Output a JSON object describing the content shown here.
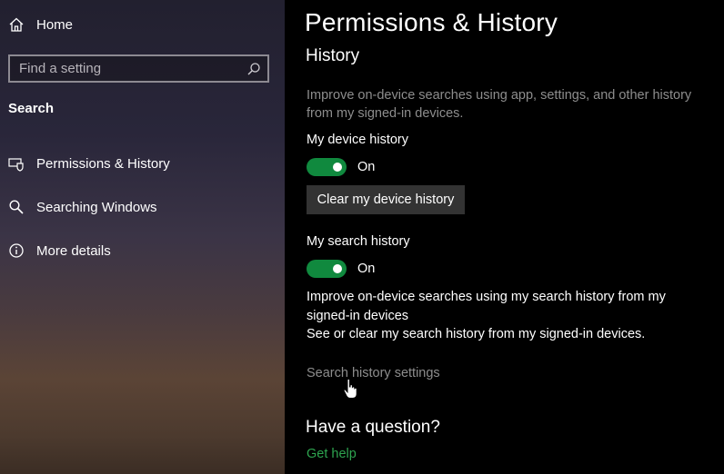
{
  "sidebar": {
    "home_label": "Home",
    "search_placeholder": "Find a setting",
    "section_title": "Search",
    "items": [
      {
        "label": "Permissions & History",
        "icon": "permissions-icon"
      },
      {
        "label": "Searching Windows",
        "icon": "search-icon"
      },
      {
        "label": "More details",
        "icon": "info-icon"
      }
    ]
  },
  "main": {
    "page_title": "Permissions & History",
    "history_heading": "History",
    "intro": "Improve on-device searches using app, settings, and other history from my signed-in devices.",
    "device_history": {
      "label": "My device history",
      "toggle_state": "On",
      "clear_button": "Clear my device history"
    },
    "search_history": {
      "label": "My search history",
      "toggle_state": "On",
      "desc_line1": "Improve on-device searches using my search history from my signed-in devices",
      "desc_line2": "See or clear my search history from my signed-in devices.",
      "settings_link": "Search history settings"
    },
    "question_heading": "Have a question?",
    "help_link": "Get help"
  },
  "colors": {
    "accent_toggle": "#10893e",
    "link_green": "#2ea44f",
    "muted_text": "#8d8d8d",
    "button_bg": "#333333"
  }
}
